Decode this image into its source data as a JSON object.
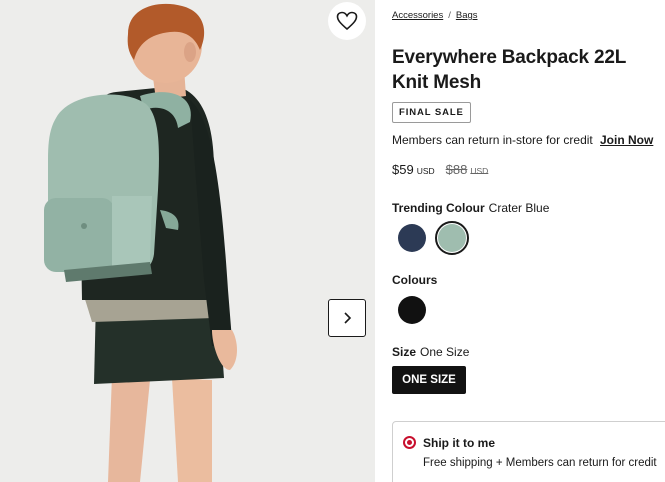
{
  "gallery": {
    "wishlist_icon": "heart-outline-icon",
    "next_icon": "chevron-right-icon"
  },
  "breadcrumb": {
    "items": [
      "Accessories",
      "Bags"
    ],
    "separator": "/"
  },
  "product": {
    "title": "Everywhere Backpack 22L Knit Mesh",
    "badge": "FINAL SALE",
    "members_text": "Members can return in-store for credit",
    "join_label": "Join Now",
    "price": "$59",
    "price_currency": "USD",
    "original_price": "$88",
    "original_currency": "USD"
  },
  "colour": {
    "trending_label": "Trending Colour",
    "trending_value": "Crater Blue",
    "trending_swatches": [
      {
        "color": "#2c3a55",
        "selected": false
      },
      {
        "color": "#9fbdaf",
        "selected": true
      }
    ],
    "colours_label": "Colours",
    "colour_swatches": [
      {
        "color": "#111111",
        "selected": false
      }
    ]
  },
  "size": {
    "label": "Size",
    "value": "One Size",
    "button_label": "ONE SIZE"
  },
  "shipping": {
    "title": "Ship it to me",
    "subtitle": "Free shipping + Members can return for credit"
  },
  "colors": {
    "accent_red": "#c8102e",
    "backpack": "#9fbdaf"
  }
}
